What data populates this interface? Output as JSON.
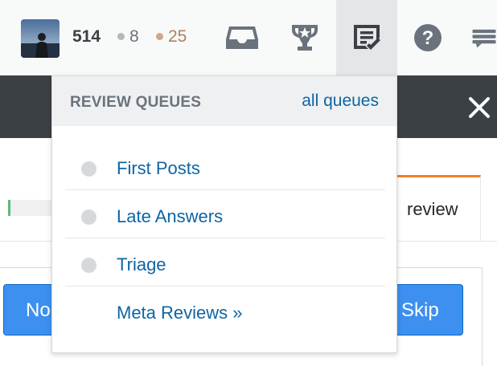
{
  "topbar": {
    "reputation": "514",
    "silver_badges": "8",
    "bronze_badges": "25",
    "icons": [
      "inbox-icon",
      "achievements-trophy-icon",
      "review-queue-icon",
      "help-icon",
      "site-switcher-icon"
    ]
  },
  "review_dropdown": {
    "title": "REVIEW QUEUES",
    "all_link": "all queues",
    "items": [
      {
        "label": "First Posts",
        "indicator": "grey-dot"
      },
      {
        "label": "Late Answers",
        "indicator": "grey-dot"
      },
      {
        "label": "Triage",
        "indicator": "grey-dot"
      },
      {
        "label": "Meta Reviews »",
        "indicator": "none"
      }
    ]
  },
  "background_page": {
    "tab_label": "review",
    "left_button_label": "No",
    "skip_button_label": "Skip"
  },
  "colors": {
    "link": "#0c65a5",
    "accent_orange": "#f48024",
    "button_blue": "#3d90f0",
    "dark_bar": "#3b4045"
  }
}
